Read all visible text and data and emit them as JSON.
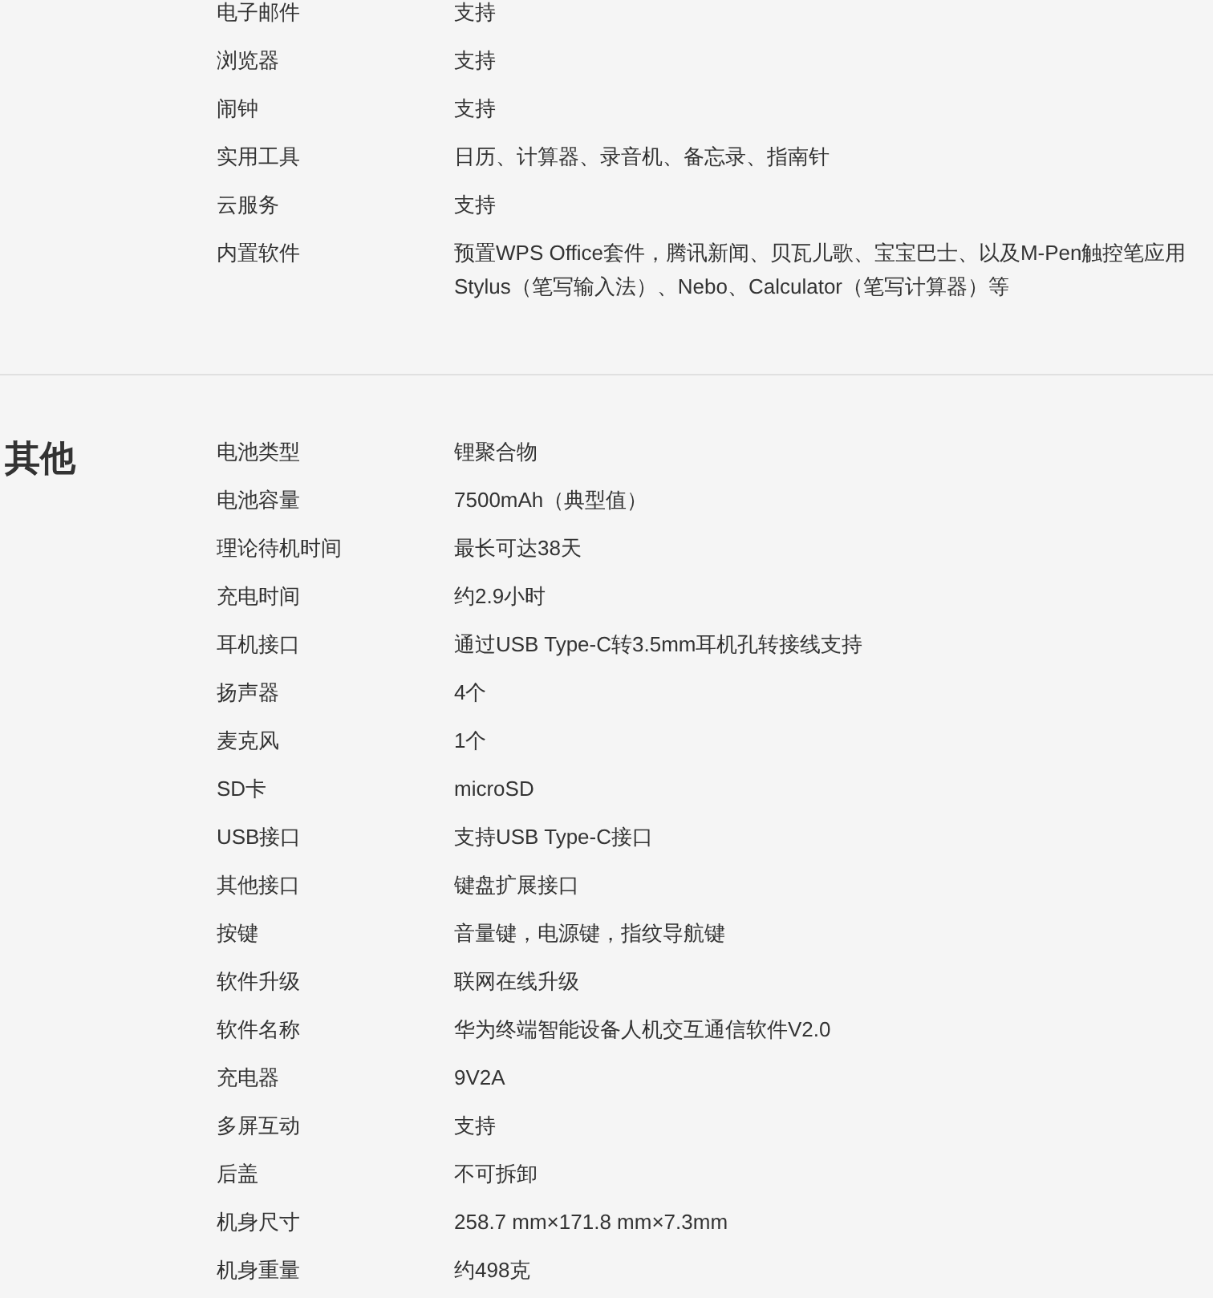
{
  "sections": [
    {
      "rows": [
        {
          "label": "电子邮件",
          "value": "支持"
        },
        {
          "label": "浏览器",
          "value": "支持"
        },
        {
          "label": "闹钟",
          "value": "支持"
        },
        {
          "label": "实用工具",
          "value": "日历、计算器、录音机、备忘录、指南针"
        },
        {
          "label": "云服务",
          "value": "支持"
        },
        {
          "label": "内置软件",
          "value": "预置WPS Office套件，腾讯新闻、贝瓦儿歌、宝宝巴士、以及M-Pen触控笔应用Stylus（笔写输入法）、Nebo、Calculator（笔写计算器）等"
        }
      ]
    },
    {
      "title": "其他",
      "rows": [
        {
          "label": "电池类型",
          "value": "锂聚合物"
        },
        {
          "label": "电池容量",
          "value": "7500mAh（典型值）"
        },
        {
          "label": "理论待机时间",
          "value": "最长可达38天"
        },
        {
          "label": "充电时间",
          "value": "约2.9小时"
        },
        {
          "label": "耳机接口",
          "value": "通过USB Type-C转3.5mm耳机孔转接线支持"
        },
        {
          "label": "扬声器",
          "value": "4个"
        },
        {
          "label": "麦克风",
          "value": "1个"
        },
        {
          "label": "SD卡",
          "value": "microSD"
        },
        {
          "label": "USB接口",
          "value": "支持USB Type-C接口"
        },
        {
          "label": "其他接口",
          "value": "键盘扩展接口"
        },
        {
          "label": "按键",
          "value": "音量键，电源键，指纹导航键"
        },
        {
          "label": "软件升级",
          "value": "联网在线升级"
        },
        {
          "label": "软件名称",
          "value": "华为终端智能设备人机交互通信软件V2.0"
        },
        {
          "label": "充电器",
          "value": "9V2A"
        },
        {
          "label": "多屏互动",
          "value": "支持"
        },
        {
          "label": "后盖",
          "value": "不可拆卸"
        },
        {
          "label": "机身尺寸",
          "value": "258.7 mm×171.8 mm×7.3mm"
        },
        {
          "label": "机身重量",
          "value": "约498克"
        }
      ]
    }
  ]
}
